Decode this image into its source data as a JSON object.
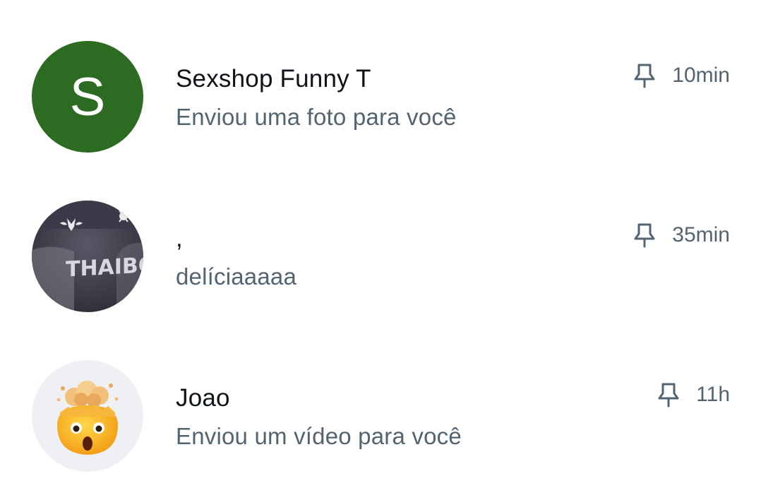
{
  "conversations": [
    {
      "name": "Sexshop Funny T",
      "preview": "Enviou uma foto para você",
      "time": "10min",
      "avatar_letter": "S",
      "avatar_color": "#2e6b22",
      "pinned": true,
      "pin_icon": "pin-icon"
    },
    {
      "name": ",",
      "preview": "delíciaaaaa",
      "time": "35min",
      "avatar_text": "THAIBOY",
      "avatar_type": "photo",
      "pinned": true,
      "pin_icon": "pin-icon"
    },
    {
      "name": "Joao",
      "preview": "Enviou um vídeo para você",
      "time": "11h",
      "avatar_type": "exploding-head-emoji",
      "avatar_bg": "#eef0f3",
      "pinned": true,
      "pin_icon": "pin-icon"
    }
  ],
  "colors": {
    "name_text": "#0f1419",
    "secondary_text": "#536471",
    "background": "#ffffff"
  }
}
